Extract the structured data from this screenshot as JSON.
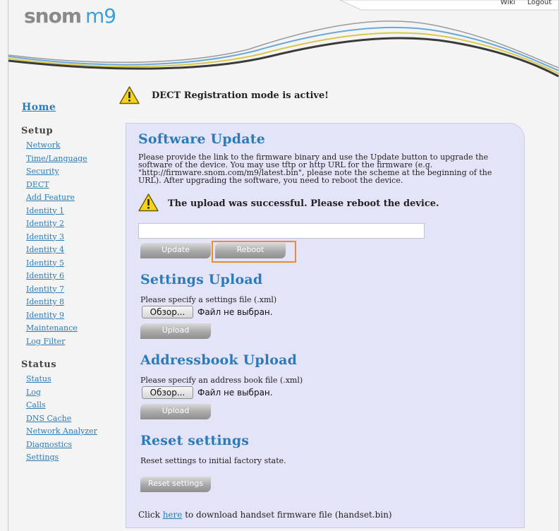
{
  "header": {
    "logo_brand": "snom",
    "logo_model": "m9",
    "wiki_link": "Wiki",
    "logout_link": "Logout"
  },
  "notice": {
    "dect_message": "DECT Registration mode is active!"
  },
  "sidebar": {
    "home": "Home",
    "setup_heading": "Setup",
    "setup_items": [
      "Network",
      "Time/Language",
      "Security",
      "DECT",
      "Add Feature",
      "Identity 1",
      "Identity 2",
      "Identity 3",
      "Identity 4",
      "Identity 5",
      "Identity 6",
      "Identity 7",
      "Identity 8",
      "Identity 9",
      "Maintenance",
      "Log Filter"
    ],
    "status_heading": "Status",
    "status_items": [
      "Status",
      "Log",
      "Calls",
      "DNS Cache",
      "Network Analyzer",
      "Diagnostics",
      "Settings"
    ]
  },
  "software_update": {
    "title": "Software Update",
    "description_lines": [
      "Please provide the link to the firmware binary and use the Update button to upgrade the",
      "software of the device. You may use tftp or http URL for the firmware (e.g.",
      "\"http://firmware.snom.com/m9/latest.bin\", please note the scheme at the beginning of the",
      "URL). After upgrading the software, you need to reboot the device."
    ],
    "success_message": "The upload was successful. Please reboot the device.",
    "url_value": "",
    "update_button": "Update",
    "reboot_button": "Reboot"
  },
  "settings_upload": {
    "title": "Settings Upload",
    "description": "Please specify a settings file (.xml)",
    "browse_button": "Обзор...",
    "no_file_text": "Файл не выбран.",
    "upload_button": "Upload"
  },
  "addressbook_upload": {
    "title": "Addressbook Upload",
    "description": "Please specify an address book file (.xml)",
    "browse_button": "Обзор...",
    "no_file_text": "Файл не выбран.",
    "upload_button": "Upload"
  },
  "reset_settings": {
    "title": "Reset settings",
    "description": "Reset settings to initial factory state.",
    "reset_button": "Reset settings"
  },
  "handset": {
    "prefix": "Click",
    "link_text": "here",
    "suffix": "to download handset firmware file (handset.bin)"
  },
  "colors": {
    "accent_blue": "#2b7bb9",
    "panel_bg": "#e3e4f8",
    "highlight_orange": "#f08a2a",
    "warning_yellow": "#f4d21f"
  }
}
